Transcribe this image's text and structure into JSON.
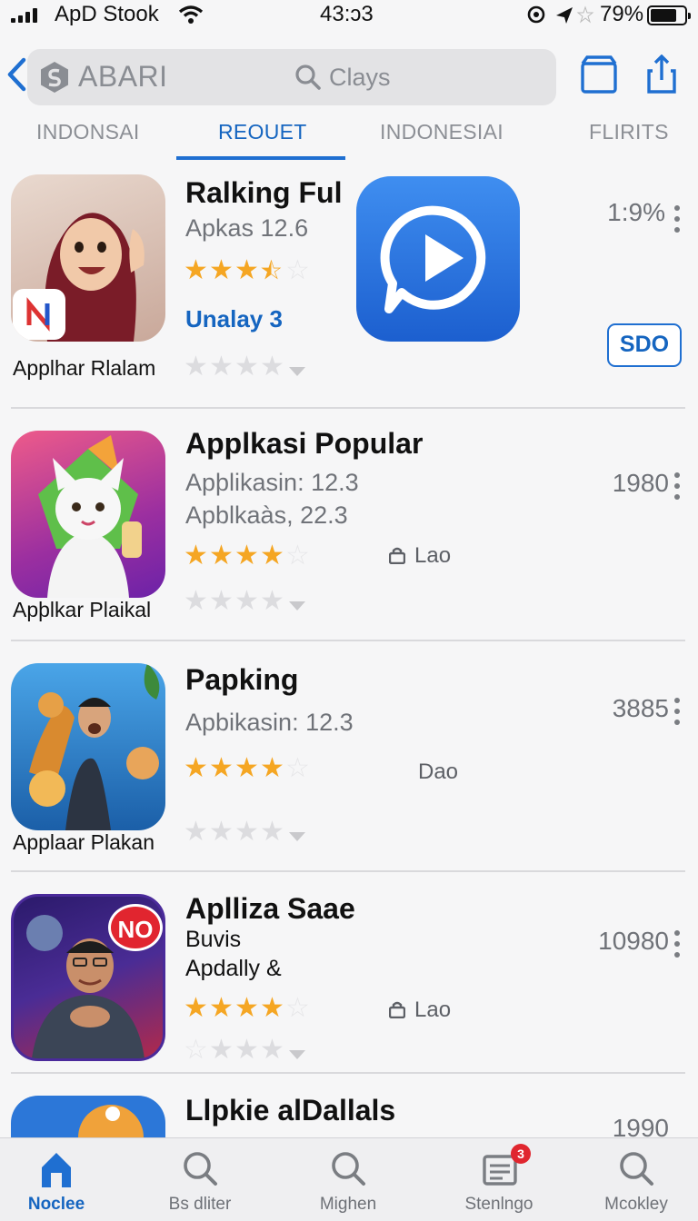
{
  "status_bar": {
    "carrier": "ApD Stook",
    "time": "43:ɔ3",
    "battery_percent": "79%",
    "battery_level": 0.79
  },
  "header": {
    "brand": "ABARI",
    "search_placeholder": "Clays"
  },
  "tabs": [
    {
      "label": "INDONSAI",
      "active": false
    },
    {
      "label": "REOUET",
      "active": true
    },
    {
      "label": "INDONESIAI",
      "active": false
    },
    {
      "label": "FLIRITS",
      "active": false
    }
  ],
  "apps": [
    {
      "title": "Ralking Ful",
      "subtitle": "Apkas 12.6",
      "rating": 3.5,
      "link": "Unalay 3",
      "caption": "Applhar Rlalam",
      "metric": "1:9%",
      "action_label": "SDO"
    },
    {
      "title": "Applkasi Popular",
      "subtitle": "Apþlikasin: 12.3",
      "subtitle2": "Apblkaàs, 22.3",
      "rating": 4,
      "tag": "Lao",
      "caption": "Apþlkar Plaikal",
      "metric": "1980"
    },
    {
      "title": "Papking",
      "subtitle": "Apbikasin: 12.3",
      "rating": 4,
      "tag": "Dao",
      "caption": "Applaar Plakan",
      "metric": "3885"
    },
    {
      "title": "Aplliza Saae",
      "subtitle": "Buvis",
      "subtitle2": "Apdally &",
      "rating": 4,
      "tag": "Lao",
      "badge": "NO",
      "metric": "10980"
    },
    {
      "title": "Llpkie alDallals",
      "metric": "1990"
    }
  ],
  "tabbar": [
    {
      "label": "Noclee",
      "icon": "home-icon",
      "active": true
    },
    {
      "label": "Bs dliter",
      "icon": "search-icon",
      "active": false
    },
    {
      "label": "Mighen",
      "icon": "search-icon",
      "active": false
    },
    {
      "label": "Stenlngo",
      "icon": "news-icon",
      "active": false,
      "badge": "3"
    },
    {
      "label": "Mcokley",
      "icon": "search-icon",
      "active": false
    }
  ],
  "colors": {
    "accent": "#1565c0",
    "star": "#f5a623",
    "badge": "#e0262f"
  }
}
